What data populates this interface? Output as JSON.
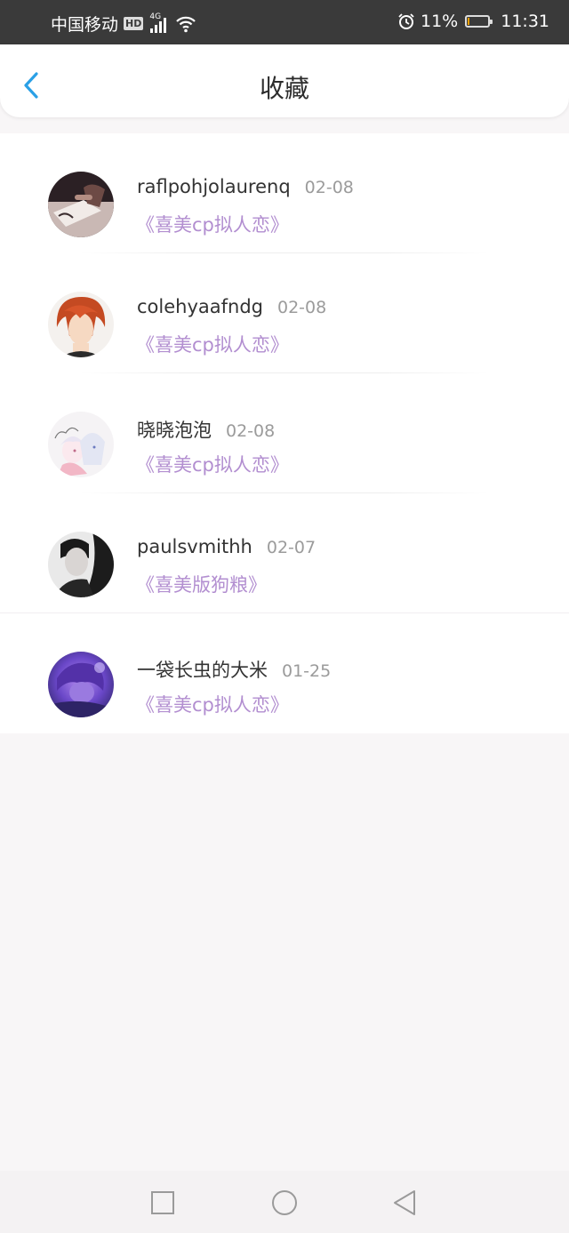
{
  "status_bar": {
    "carrier": "中国移动",
    "hd": "HD",
    "network": "4G",
    "battery_percent_text": "11%",
    "battery_level": 0.11,
    "time": "11:31"
  },
  "header": {
    "title": "收藏",
    "back_icon": "chevron-left-icon"
  },
  "favorites": [
    {
      "name": "raflpohjolaurenq",
      "date": "02-08",
      "book": "《喜美cp拟人恋》"
    },
    {
      "name": "colehyaafndg",
      "date": "02-08",
      "book": "《喜美cp拟人恋》"
    },
    {
      "name": "晓晓泡泡",
      "date": "02-08",
      "book": "《喜美cp拟人恋》"
    },
    {
      "name": "paulsvmithh",
      "date": "02-07",
      "book": "《喜美版狗粮》"
    },
    {
      "name": "一袋长虫的大米",
      "date": "01-25",
      "book": "《喜美cp拟人恋》"
    }
  ],
  "colors": {
    "accent": "#2aa0e6",
    "book_title": "#b28ed0",
    "date": "#9b9b9b",
    "status_bar": "#3a3a3a"
  },
  "nav_icons": [
    "recent-apps-icon",
    "home-icon",
    "back-icon"
  ]
}
